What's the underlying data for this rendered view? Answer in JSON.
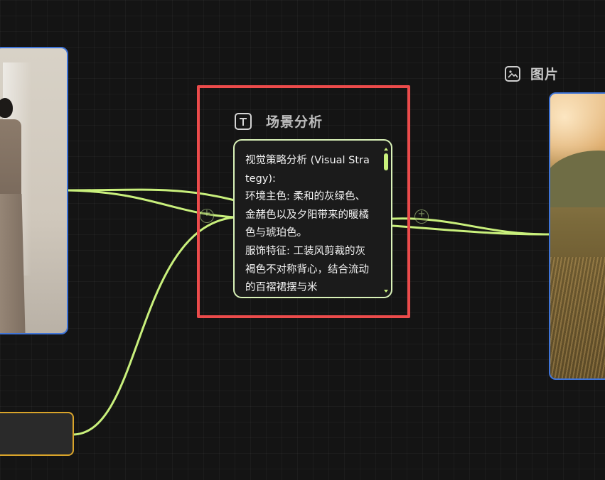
{
  "image_node_right": {
    "title": "图片",
    "icon": "image-icon"
  },
  "text_node": {
    "title": "场景分析",
    "icon": "text-icon",
    "content": "视觉策略分析 (Visual Strategy):\n环境主色: 柔和的灰绿色、金赭色以及夕阳带来的暖橘色与琥珀色。\n服饰特征: 工装风剪裁的灰褐色不对称背心，结合流动的百褶裙摆与米"
  },
  "colors": {
    "canvas_bg": "#141414",
    "edge": "#c9f07c",
    "image_node_border": "#3f74d8",
    "input_node_border": "#d9a42a",
    "highlight": "#ec4b4b",
    "text_node_border": "#d9f2b8"
  }
}
